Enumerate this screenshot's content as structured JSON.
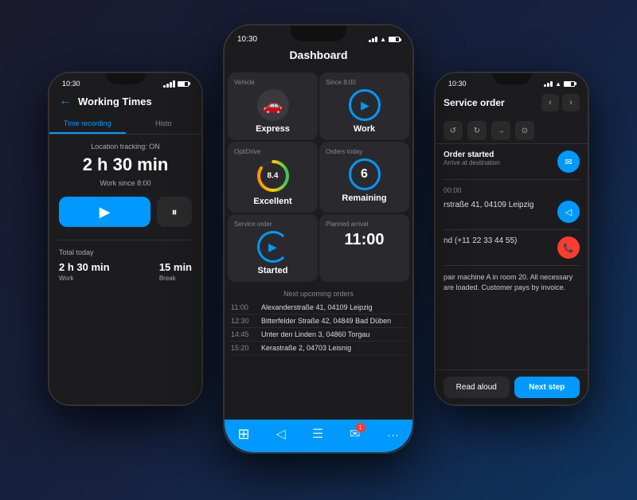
{
  "left_phone": {
    "status_time": "10:30",
    "title": "Working Times",
    "tab_active": "Time recording",
    "tab_inactive": "Histo",
    "location_text": "Location tracking: ON",
    "big_time": "2 h 30 min",
    "work_since": "Work since 8:00",
    "total_label": "Total today",
    "total_work": "2 h 30 min",
    "total_work_label": "Work",
    "break_time": "15 min",
    "break_label": "Break"
  },
  "center_phone": {
    "status_time": "10:30",
    "title": "Dashboard",
    "cards": [
      {
        "label": "Vehicle",
        "title": "Express",
        "type": "vehicle"
      },
      {
        "label": "Since 8:00",
        "title": "Work",
        "type": "work"
      },
      {
        "label": "OptiDrive",
        "title": "Excellent",
        "value": "8.4",
        "type": "gauge"
      },
      {
        "label": "Orders today",
        "title": "Remaining",
        "value": "6",
        "type": "orders"
      },
      {
        "label": "Service order",
        "title": "Started",
        "type": "service"
      },
      {
        "label": "Planned arrival",
        "value": "11:00",
        "type": "time"
      }
    ],
    "upcoming_title": "Next upcoming orders",
    "orders": [
      {
        "time": "11:00",
        "address": "Alexanderstraße 41, 04109 Leipzig"
      },
      {
        "time": "12:30",
        "address": "Bitterfelder Straße 42, 04849 Bad Düben"
      },
      {
        "time": "14:45",
        "address": "Unter den Linden 3, 04860 Torgau"
      },
      {
        "time": "15:20",
        "address": "Kerastraße 2, 04703 Leisnig"
      }
    ],
    "nav": {
      "dashboard_icon": "⊞",
      "location_icon": "◁",
      "orders_icon": "☰",
      "messages_icon": "✉",
      "more_icon": "…",
      "badge": "1"
    }
  },
  "right_phone": {
    "status_time": "10:30",
    "title": "Service order",
    "toolbar_icons": [
      "↺",
      "↻",
      "→→",
      "⊙"
    ],
    "order_status_label": "Order started",
    "order_status_sub": "Arrive at destination",
    "time_label": "00:00",
    "address": "rstraße 41, 04109 Leipzig",
    "phone": "nd (+11 22 33 44 55)",
    "description": "pair machine A in room 20. All necessary are loaded. Customer pays by invoice.",
    "read_aloud": "Read aloud",
    "next_step": "Next step"
  },
  "colors": {
    "blue": "#0099ff",
    "dark_bg": "#1c1c1e",
    "card_bg": "#2a2a2e",
    "text_primary": "#ffffff",
    "text_secondary": "#888888",
    "green": "#34c759",
    "red": "#ff3b30"
  }
}
